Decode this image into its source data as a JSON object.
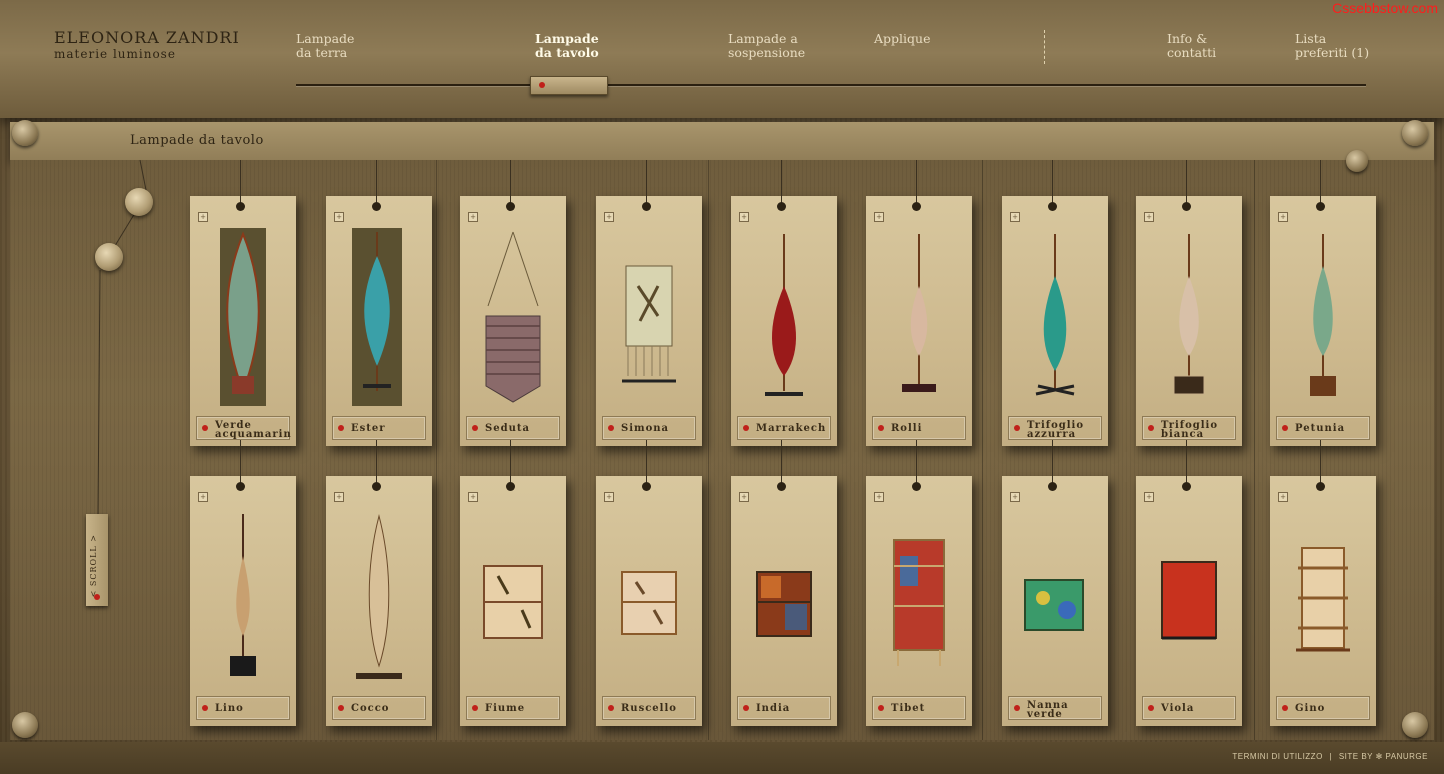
{
  "brand": {
    "name": "ELEONORA ZANDRI",
    "subtitle": "materie luminose"
  },
  "watermark": "Cssebbstow.com",
  "nav": [
    {
      "label": "Lampade\nda terra",
      "active": false
    },
    {
      "label": "Lampade\nda tavolo",
      "active": true
    },
    {
      "label": "Lampade a\nsospensione",
      "active": false
    },
    {
      "label": "Applique",
      "active": false
    },
    {
      "label": "Info &\ncontatti",
      "active": false
    },
    {
      "label": "Lista\npreferiti   (1)",
      "active": false
    }
  ],
  "section_title": "Lampade da tavolo",
  "scroll_label": "< SCROLL >",
  "products_row1": [
    "Verde\nacquamarin",
    "Ester",
    "Seduta",
    "Simona",
    "Marrakech",
    "Rolli",
    "Trifoglio\nazzurra",
    "Trifoglio\nbianca",
    "Petunia"
  ],
  "products_row2": [
    "Lino",
    "Cocco",
    "Fiume",
    "Ruscello",
    "India",
    "Tibet",
    "Nanna\nverde",
    "Viola",
    "Gino"
  ],
  "footer": {
    "terms": "TERMINI DI UTILIZZO",
    "separator": "|",
    "site_by": "SITE BY ✻ PANURGE"
  },
  "colors": {
    "accent_red": "#c0201a"
  }
}
